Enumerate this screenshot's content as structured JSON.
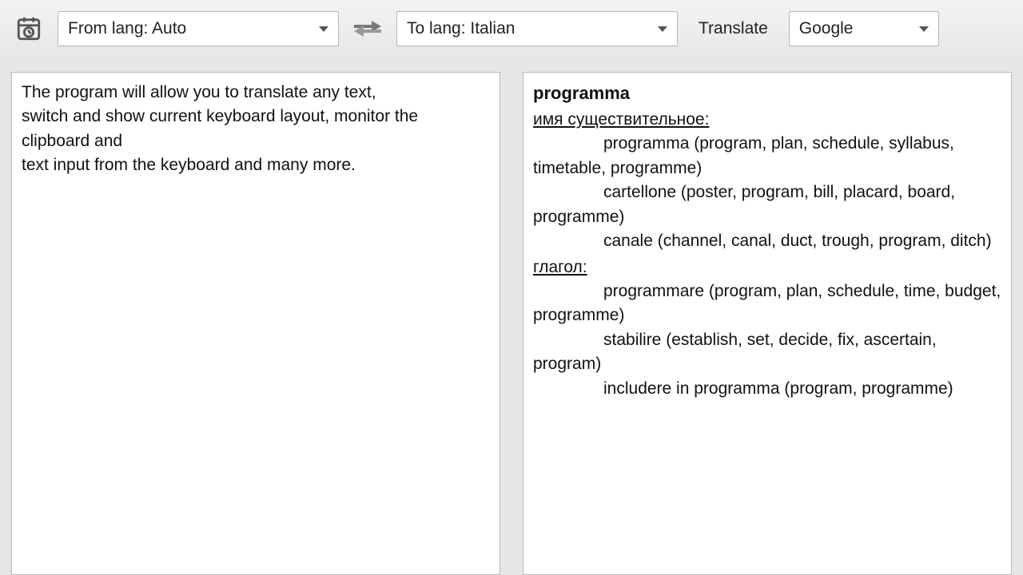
{
  "toolbar": {
    "from_lang_label": "From lang: Auto",
    "to_lang_label": "To lang: Italian",
    "translate_label": "Translate",
    "engine_label": "Google"
  },
  "source_text_lines": [
    "The program will allow you to translate any text,",
    "switch and show current keyboard layout, monitor the clipboard and",
    "text input from the keyboard and many more."
  ],
  "result": {
    "headword": "programma",
    "groups": [
      {
        "part_of_speech": "имя существительное:",
        "senses": [
          "programma (program, plan, schedule, syllabus, timetable, programme)",
          "cartellone (poster, program, bill, placard, board, programme)",
          "canale (channel, canal, duct, trough, program, ditch)"
        ]
      },
      {
        "part_of_speech": "глагол:",
        "senses": [
          "programmare (program, plan, schedule, time, budget, programme)",
          "stabilire (establish, set, decide, fix, ascertain, program)",
          "includere in programma (program, programme)"
        ]
      }
    ]
  }
}
